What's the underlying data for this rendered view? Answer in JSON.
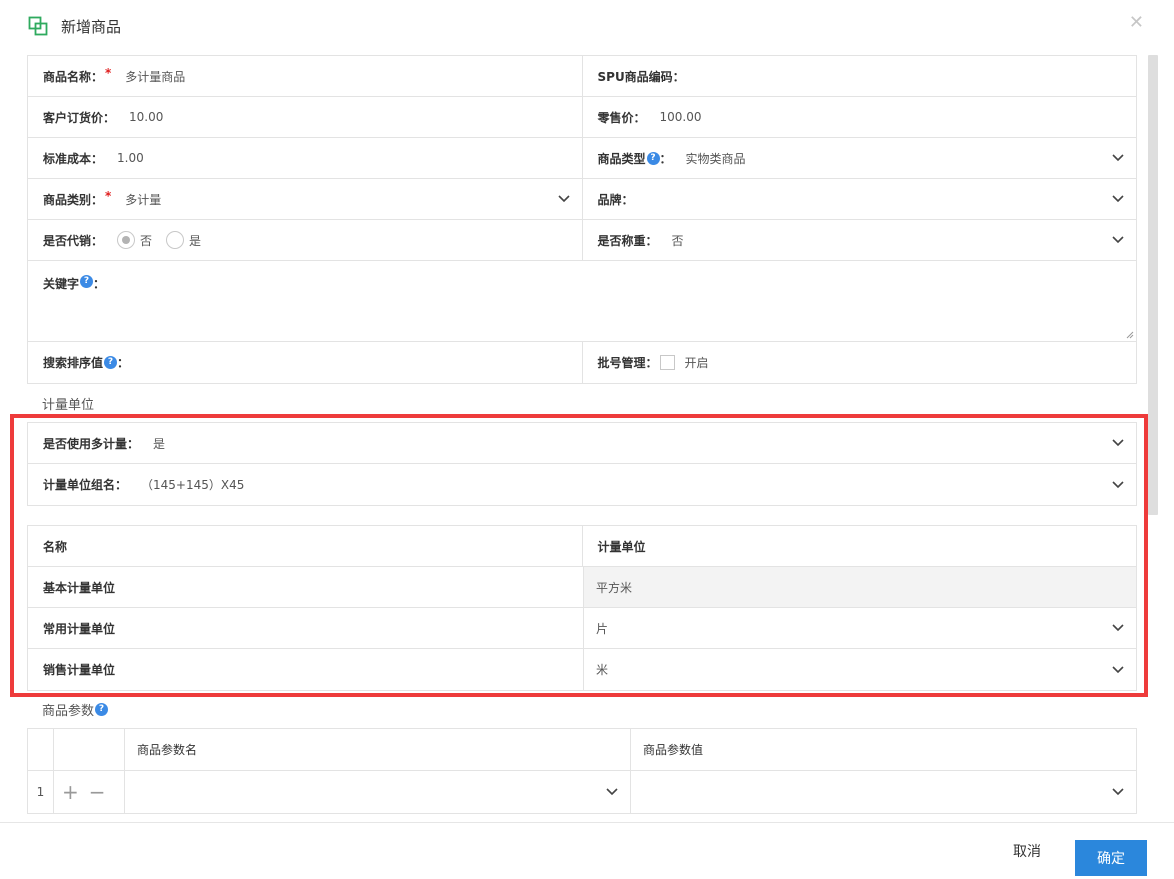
{
  "dialog": {
    "title": "新增商品",
    "close_icon": "close-icon"
  },
  "form": {
    "product_name": {
      "label": "商品名称：",
      "required_mark": "*",
      "value": "多计量商品"
    },
    "spu_code": {
      "label": "SPU商品编码：",
      "value": ""
    },
    "order_price": {
      "label": "客户订货价：",
      "value": "10.00"
    },
    "retail_price": {
      "label": "零售价：",
      "value": "100.00"
    },
    "standard_cost": {
      "label": "标准成本：",
      "value": "1.00"
    },
    "product_type": {
      "label": "商品类型",
      "help": "?",
      "colon": "：",
      "value": "实物类商品"
    },
    "category": {
      "label": "商品类别：",
      "required_mark": "*",
      "value": "多计量"
    },
    "brand": {
      "label": "品牌：",
      "value": ""
    },
    "consignment": {
      "label": "是否代销：",
      "options": [
        "否",
        "是"
      ],
      "selected": "否"
    },
    "weighing": {
      "label": "是否称重：",
      "value": "否"
    },
    "keywords": {
      "label": "关键字",
      "help": "?",
      "colon": "：",
      "value": ""
    },
    "search_sort": {
      "label": "搜索排序值",
      "help": "?",
      "colon": "：",
      "value": ""
    },
    "batch_mgmt": {
      "label": "批号管理：",
      "checkbox_label": "开启",
      "checked": false
    }
  },
  "units_section": {
    "title": "计量单位",
    "multi_unit": {
      "label": "是否使用多计量：",
      "value": "是"
    },
    "unit_group": {
      "label": "计量单位组名：",
      "value": "（145+145）X45"
    },
    "table": {
      "headers": [
        "名称",
        "计量单位"
      ],
      "rows": [
        {
          "name": "基本计量单位",
          "unit": "平方米"
        },
        {
          "name": "常用计量单位",
          "unit": "片"
        },
        {
          "name": "销售计量单位",
          "unit": "米"
        }
      ]
    }
  },
  "params_section": {
    "title": "商品参数",
    "help": "?",
    "headers": [
      "商品参数名",
      "商品参数值"
    ],
    "rows": [
      {
        "index": "1",
        "add": "+",
        "remove": "−"
      }
    ]
  },
  "footer": {
    "cancel_label": "取消",
    "ok_label": "确定"
  },
  "colors": {
    "accent": "#2b87dc",
    "highlight": "#ee3b3b",
    "required": "#e02020",
    "help": "#3b8ae5",
    "logo": "#2eaa5e"
  }
}
